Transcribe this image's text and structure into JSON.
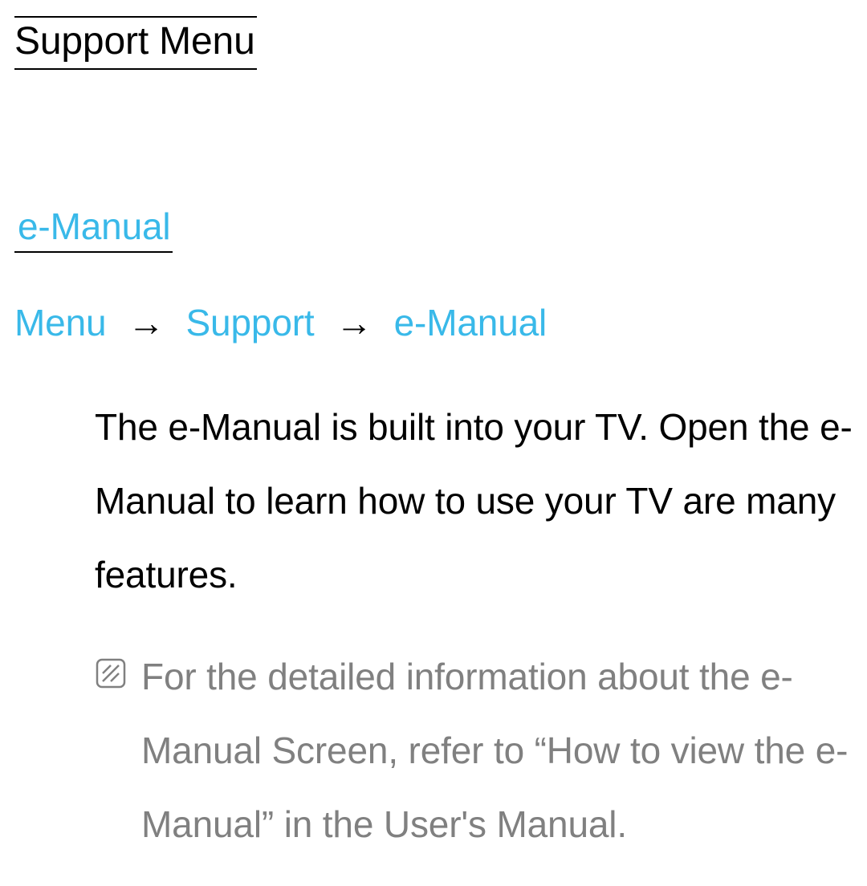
{
  "page": {
    "title": "Support Menu"
  },
  "section": {
    "title": "e-Manual"
  },
  "breadcrumb": {
    "item1": "Menu",
    "item2": "Support",
    "item3": "e-Manual",
    "separator": "→"
  },
  "body": {
    "text": "The e-Manual is built into your TV. Open the e-Manual to learn how to use your TV are many features."
  },
  "note": {
    "text": "For the detailed information about the e-Manual Screen, refer to “How to view the e-Manual” in the User's Manual."
  }
}
